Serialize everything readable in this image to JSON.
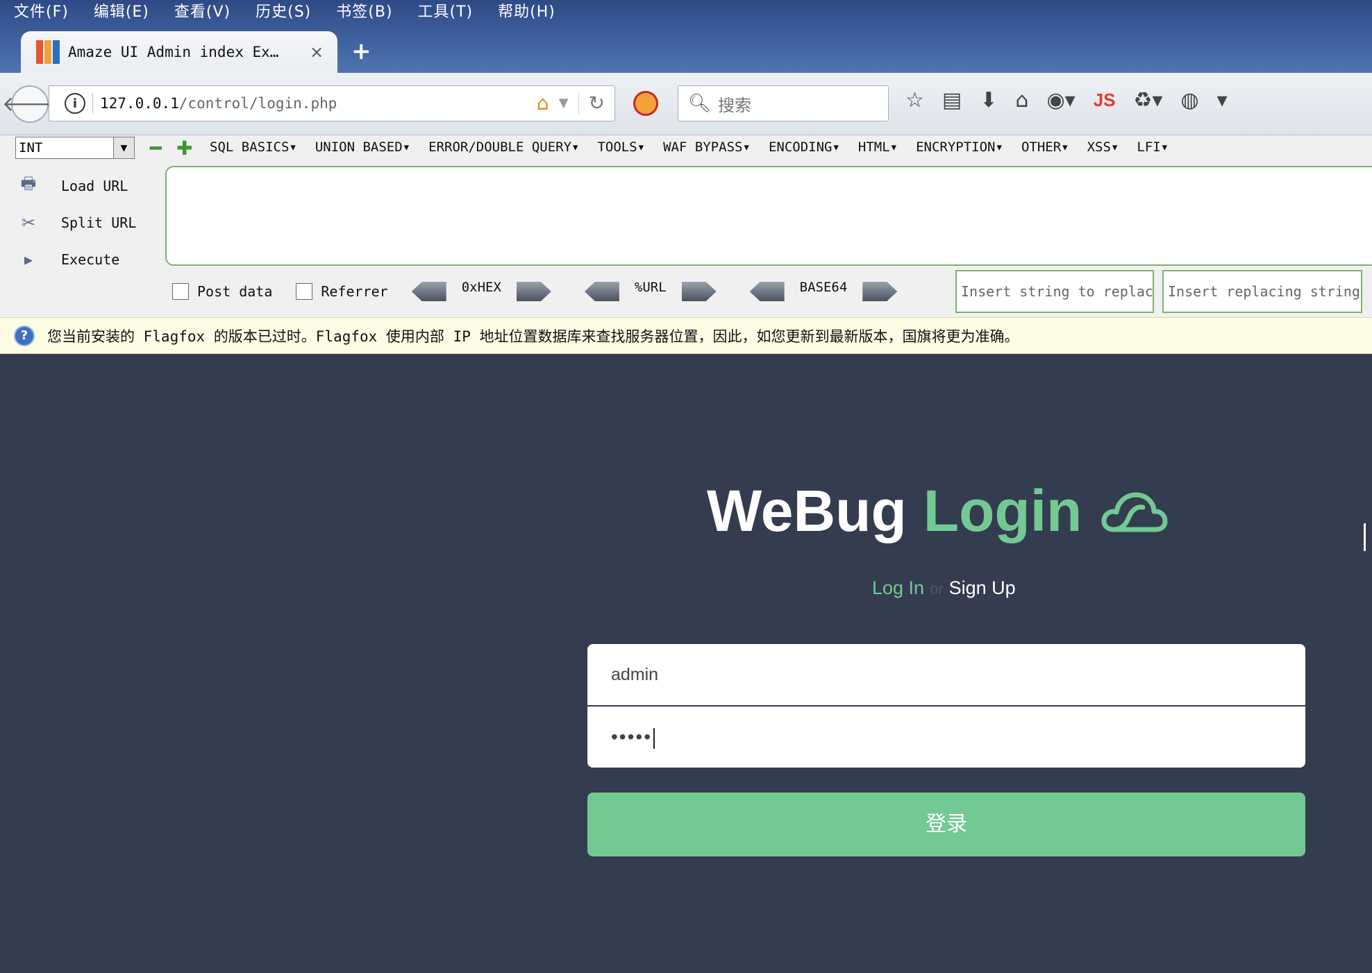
{
  "menu": [
    "文件(F)",
    "编辑(E)",
    "查看(V)",
    "历史(S)",
    "书签(B)",
    "工具(T)",
    "帮助(H)"
  ],
  "tab": {
    "title": "Amaze UI Admin index Ex…",
    "close": "×",
    "new": "+"
  },
  "address": {
    "host": "127.0.0.1",
    "path": "/control/login.php"
  },
  "search": {
    "placeholder": "搜索"
  },
  "toolbar": {
    "js_label": "JS"
  },
  "hackbar": {
    "select_value": "INT",
    "menu_items": [
      "SQL BASICS▾",
      "UNION BASED▾",
      "ERROR/DOUBLE QUERY▾",
      "TOOLS▾",
      "WAF BYPASS▾",
      "ENCODING▾",
      "HTML▾",
      "ENCRYPTION▾",
      "OTHER▾",
      "XSS▾",
      "LFI▾"
    ],
    "load_url": "Load URL",
    "split_url": "Split URL",
    "execute": "Execute",
    "post_data": "Post data",
    "referrer": "Referrer",
    "hex": "0xHEX",
    "url": "%URL",
    "base64": "BASE64",
    "replace_placeholder": "Insert string to replace",
    "replacing_placeholder": "Insert replacing string"
  },
  "notice": {
    "text": "您当前安装的 Flagfox 的版本已过时。Flagfox 使用内部 IP 地址位置数据库来查找服务器位置，因此，如您更新到最新版本，国旗将更为准确。"
  },
  "login": {
    "title_part1": "WeBug",
    "title_part2": "Login",
    "log_in": "Log In",
    "or": "or",
    "sign_up": "Sign Up",
    "username": "admin",
    "password": "•••••",
    "submit": "登录"
  },
  "colors": {
    "accent": "#73c994",
    "background": "#343c4f",
    "chrome": "#3a5a9a"
  }
}
